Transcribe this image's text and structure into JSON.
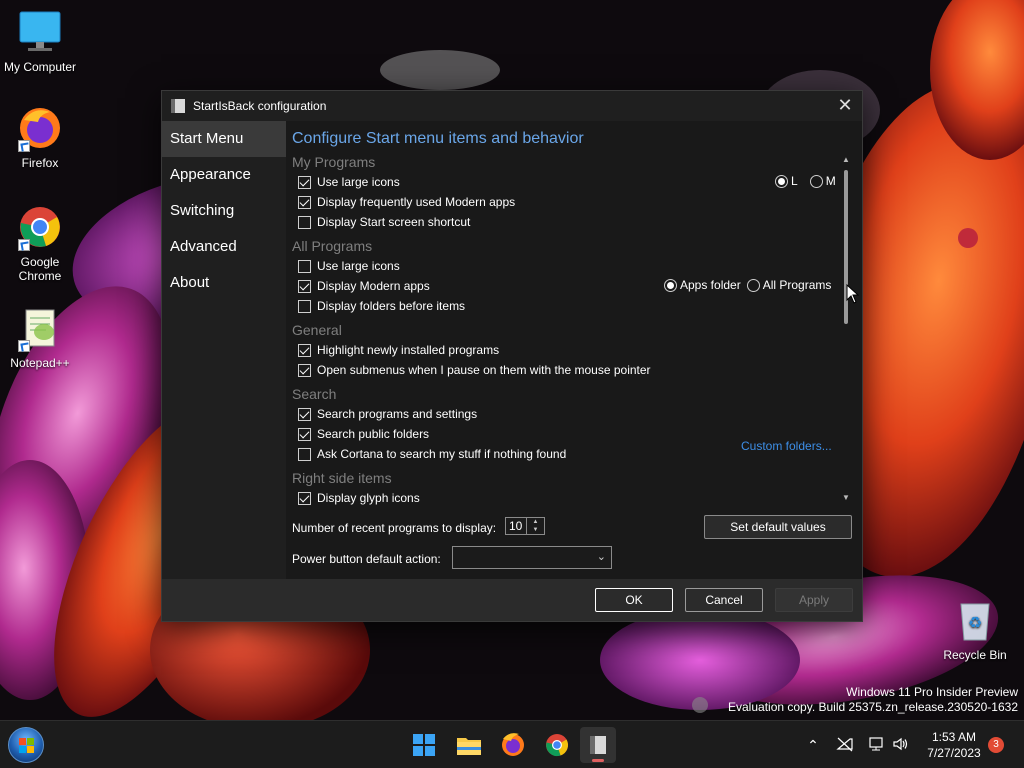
{
  "desktop": {
    "icons": [
      {
        "label": "My Computer"
      },
      {
        "label": "Firefox"
      },
      {
        "label": "Google Chrome"
      },
      {
        "label": "Notepad++"
      },
      {
        "label": "Recycle Bin"
      }
    ],
    "watermark": {
      "line1": "Windows 11 Pro Insider Preview",
      "line2": "Evaluation copy. Build 25375.zn_release.230520-1632"
    }
  },
  "dialog": {
    "title": "StartIsBack configuration",
    "close_glyph": "✕",
    "nav": [
      "Start Menu",
      "Appearance",
      "Switching",
      "Advanced",
      "About"
    ],
    "active_nav": "Start Menu",
    "heading": "Configure Start menu items and behavior",
    "sections": {
      "my_programs": {
        "title": "My Programs",
        "options": [
          {
            "label": "Use large icons",
            "checked": true
          },
          {
            "label": "Display frequently used Modern apps",
            "checked": true
          },
          {
            "label": "Display Start screen shortcut",
            "checked": false
          }
        ],
        "size_radio": {
          "options": [
            "L",
            "M"
          ],
          "selected": "L"
        }
      },
      "all_programs": {
        "title": "All Programs",
        "options": [
          {
            "label": "Use large icons",
            "checked": false
          },
          {
            "label": "Display Modern apps",
            "checked": true
          },
          {
            "label": "Display folders before items",
            "checked": false
          }
        ],
        "apps_radio": {
          "options": [
            "Apps folder",
            "All Programs"
          ],
          "selected": "Apps folder"
        }
      },
      "general": {
        "title": "General",
        "options": [
          {
            "label": "Highlight newly installed programs",
            "checked": true
          },
          {
            "label": "Open submenus when I pause on them with the mouse pointer",
            "checked": true
          }
        ]
      },
      "search": {
        "title": "Search",
        "options": [
          {
            "label": "Search programs and settings",
            "checked": true
          },
          {
            "label": "Search public folders",
            "checked": true
          },
          {
            "label": "Ask Cortana to search my stuff if nothing found",
            "checked": false
          }
        ]
      },
      "right_side": {
        "title": "Right side items",
        "options": [
          {
            "label": "Display glyph icons",
            "checked": true
          }
        ],
        "link": "Custom folders..."
      }
    },
    "recent_programs": {
      "label": "Number of recent programs to display:",
      "value": "10"
    },
    "set_default_label": "Set default values",
    "power_button": {
      "label": "Power button default action:",
      "value": ""
    },
    "buttons": {
      "ok": "OK",
      "cancel": "Cancel",
      "apply": "Apply"
    }
  },
  "taskbar": {
    "apps": [
      "start-menu",
      "file-explorer",
      "firefox",
      "chrome",
      "startisback"
    ],
    "active_app": "startisback",
    "clock": {
      "time": "1:53 AM",
      "date": "7/27/2023"
    },
    "notification_count": "3"
  },
  "colors": {
    "accent_heading": "#6aa6e8",
    "link": "#3d8ee6",
    "dialog_bg": "#191919",
    "badge": "#e24b35"
  }
}
